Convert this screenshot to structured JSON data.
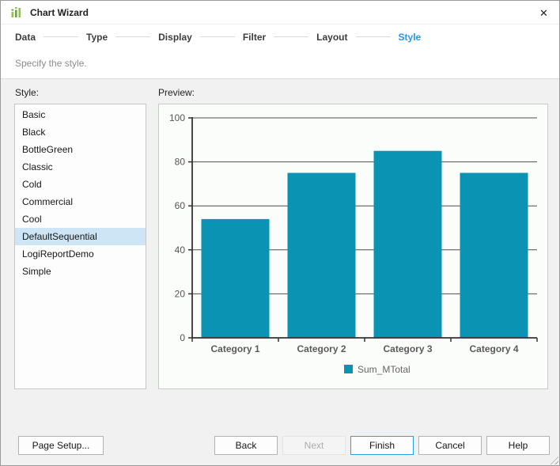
{
  "window": {
    "title": "Chart Wizard",
    "close_glyph": "✕"
  },
  "steps": {
    "items": [
      "Data",
      "Type",
      "Display",
      "Filter",
      "Layout",
      "Style"
    ],
    "active": "Style"
  },
  "subtitle": "Specify the style.",
  "style_panel": {
    "label": "Style:",
    "options": [
      "Basic",
      "Black",
      "BottleGreen",
      "Classic",
      "Cold",
      "Commercial",
      "Cool",
      "DefaultSequential",
      "LogiReportDemo",
      "Simple"
    ],
    "selected": "DefaultSequential"
  },
  "preview": {
    "label": "Preview:"
  },
  "chart_data": {
    "type": "bar",
    "title": "",
    "xlabel": "",
    "ylabel": "",
    "categories": [
      "Category 1",
      "Category 2",
      "Category 3",
      "Category 4"
    ],
    "series": [
      {
        "name": "Sum_MTotal",
        "values": [
          54,
          75,
          85,
          75
        ],
        "color": "#0a93b2"
      }
    ],
    "ylim": [
      0,
      100
    ],
    "yticks": [
      0,
      20,
      40,
      60,
      80,
      100
    ],
    "grid": true,
    "legend_position": "bottom"
  },
  "footer": {
    "page_setup": "Page Setup...",
    "back": "Back",
    "next": "Next",
    "finish": "Finish",
    "cancel": "Cancel",
    "help": "Help"
  },
  "colors": {
    "accent_blue": "#2196f3",
    "bar_teal": "#0a93b2",
    "selection_bg": "#cde5f4",
    "finish_border": "#2e9be5",
    "icon_green_light": "#8bc53f",
    "icon_green_dark": "#5fae3b"
  }
}
